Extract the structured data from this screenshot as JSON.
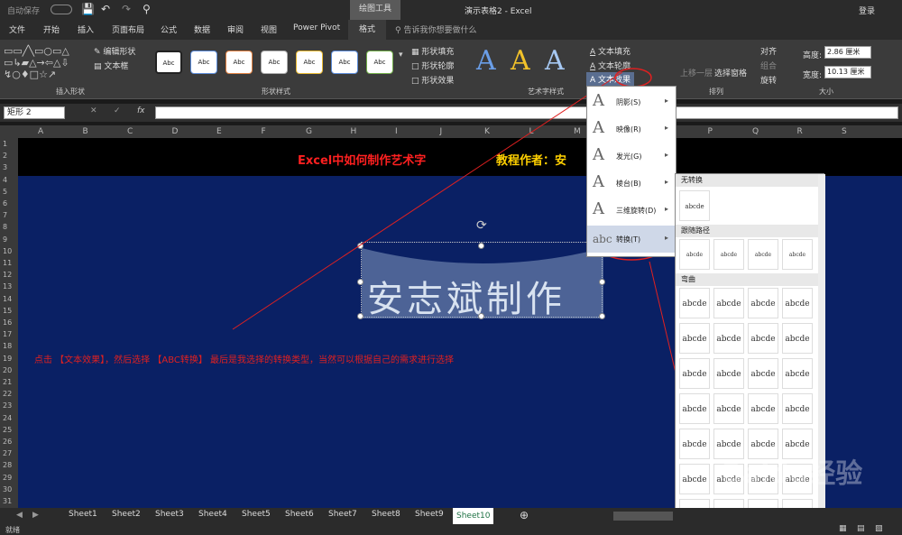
{
  "titlebar": {
    "autosave": "自动保存",
    "tool_title": "绘图工具",
    "doc_title": "演示表格2 - Excel",
    "login": "登录"
  },
  "tabs": [
    "文件",
    "开始",
    "插入",
    "页面布局",
    "公式",
    "数据",
    "审阅",
    "视图",
    "Power Pivot",
    "格式"
  ],
  "tell_me": "告诉我你想要做什么",
  "ribbon": {
    "edit_shape": "编辑形状",
    "text_box": "文本框",
    "insert_shapes": "插入形状",
    "style_chip": "Abc",
    "shape_styles": "形状样式",
    "shape_fill": "形状填充",
    "shape_outline": "形状轮廓",
    "shape_effects": "形状效果",
    "wordart_styles": "艺术字样式",
    "text_fill": "文本填充",
    "text_outline": "文本轮廓",
    "text_effects": "文本效果",
    "bring_forward": "上移一层",
    "send_backward": "下移一层",
    "selection_pane": "选择窗格",
    "align": "对齐",
    "group": "组合",
    "rotate": "旋转",
    "arrange": "排列",
    "height_label": "高度:",
    "height_value": "2.86 厘米",
    "width_label": "宽度:",
    "width_value": "10.13 厘米",
    "size": "大小"
  },
  "formula": {
    "namebox": "矩形 2",
    "fx": "fx"
  },
  "columns": [
    "A",
    "B",
    "C",
    "D",
    "E",
    "F",
    "G",
    "H",
    "I",
    "J",
    "K",
    "L",
    "M",
    "N",
    "O",
    "P",
    "Q",
    "R",
    "S"
  ],
  "rows": [
    "1",
    "2",
    "3",
    "4",
    "5",
    "6",
    "7",
    "8",
    "9",
    "10",
    "11",
    "12",
    "13",
    "14",
    "15",
    "16",
    "17",
    "18",
    "19",
    "20",
    "21",
    "22",
    "23",
    "24",
    "25",
    "26",
    "27",
    "28",
    "29",
    "30",
    "31"
  ],
  "sheet": {
    "heading1": "Excel中如何制作艺术字",
    "heading2": "教程作者：安",
    "wordart": "安志斌制作",
    "instruction": "点击 【文本效果】，然后选择 【ABC转换】   最后是我选择的转换类型，当然可以根据自己的需求进行选择"
  },
  "menu": [
    {
      "icon": "A",
      "label": "阴影(S)"
    },
    {
      "icon": "A",
      "label": "映像(R)"
    },
    {
      "icon": "A",
      "label": "发光(G)"
    },
    {
      "icon": "A",
      "label": "棱台(B)"
    },
    {
      "icon": "A",
      "label": "三维旋转(D)"
    },
    {
      "icon": "abc",
      "label": "转换(T)"
    }
  ],
  "gallery": {
    "no_transform": "无转换",
    "follow_path": "跟随路径",
    "warp": "弯曲",
    "sample": "abcde"
  },
  "sheets": [
    "Sheet1",
    "Sheet2",
    "Sheet3",
    "Sheet4",
    "Sheet5",
    "Sheet6",
    "Sheet7",
    "Sheet8",
    "Sheet9",
    "Sheet10"
  ],
  "active_sheet": "Sheet10",
  "status": "就绪",
  "watermark": "Baidu经验"
}
